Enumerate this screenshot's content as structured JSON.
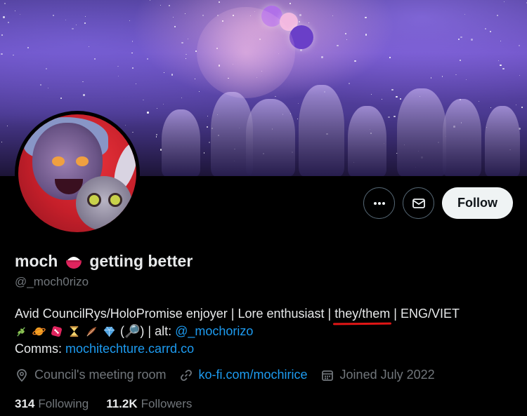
{
  "profile": {
    "display_name": "moch",
    "display_name_suffix": "getting better",
    "handle": "@_moch0rizo",
    "follow_label": "Follow"
  },
  "bio": {
    "line1_before": "Avid CouncilRys/HoloPromise enjoyer | Lore enthusiast | ",
    "line1_pronouns": "they/them",
    "line1_after": " | ENG/VIET",
    "line2_text": "(🔎) | alt: ",
    "line2_link": "@_mochorizo",
    "line3_label": "Comms: ",
    "line3_link": "mochitechture.carrd.co"
  },
  "meta": {
    "location": "Council's meeting room",
    "website": "ko-fi.com/mochirice",
    "joined": "Joined July 2022"
  },
  "stats": {
    "following_count": "314",
    "following_label": "Following",
    "followers_count": "11.2K",
    "followers_label": "Followers"
  },
  "icons": {
    "more": "more-options-icon",
    "message": "envelope-icon",
    "location": "location-pin-icon",
    "link": "link-icon",
    "calendar": "calendar-icon",
    "name_emoji": "rice-bowl-icon",
    "bio_emojis": [
      "herb-icon",
      "ringed-planet-icon",
      "dice-icon",
      "hourglass-icon",
      "feather-icon",
      "gem-icon"
    ]
  },
  "colors": {
    "background": "#000000",
    "link": "#1d9bf0",
    "muted": "#71767b",
    "follow_button": "#eff3f4",
    "annotation_underline": "#e01616"
  }
}
